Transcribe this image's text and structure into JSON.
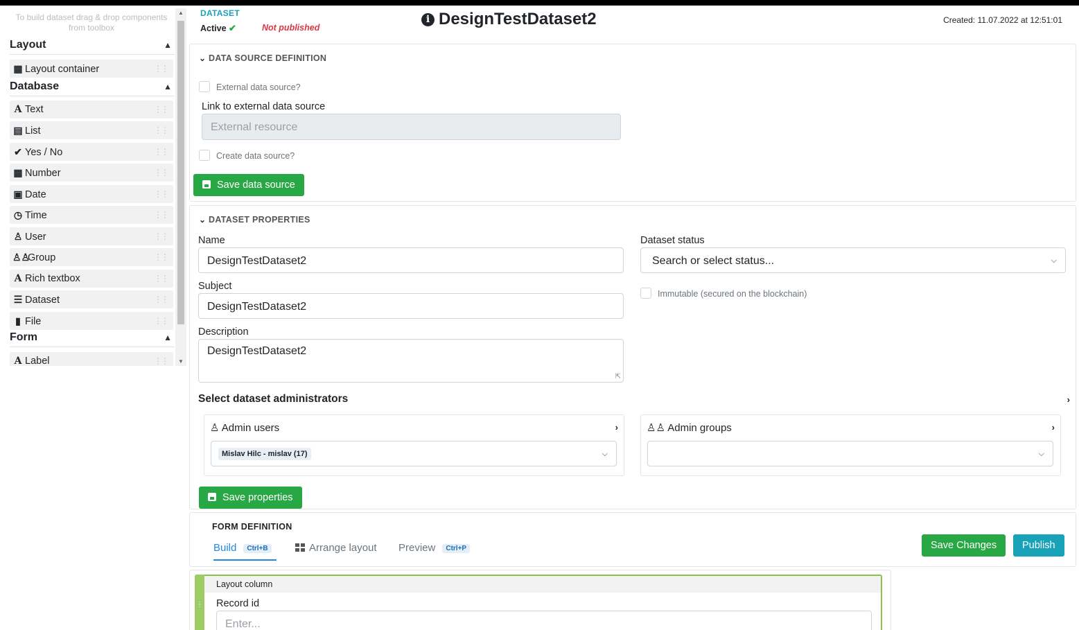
{
  "sidebar": {
    "hint": "To build dataset drag & drop components from toolbox",
    "groups": {
      "layout": "Layout",
      "database": "Database",
      "form": "Form"
    },
    "layout_items": [
      {
        "label": "Layout container",
        "icon": "layout-grid-icon"
      }
    ],
    "database_items": [
      {
        "label": "Text",
        "icon": "font-a-icon"
      },
      {
        "label": "List",
        "icon": "list-icon"
      },
      {
        "label": "Yes / No",
        "icon": "check-icon"
      },
      {
        "label": "Number",
        "icon": "calculator-icon"
      },
      {
        "label": "Date",
        "icon": "calendar-icon"
      },
      {
        "label": "Time",
        "icon": "clock-icon"
      },
      {
        "label": "User",
        "icon": "user-icon"
      },
      {
        "label": "Group",
        "icon": "users-icon"
      },
      {
        "label": "Rich textbox",
        "icon": "font-a-icon"
      },
      {
        "label": "Dataset",
        "icon": "database-icon"
      },
      {
        "label": "File",
        "icon": "file-icon"
      }
    ],
    "form_items": [
      {
        "label": "Label",
        "icon": "font-a-icon"
      }
    ]
  },
  "header": {
    "kind": "DATASET",
    "status": "Active",
    "publish_state": "Not published",
    "title": "DesignTestDataset2",
    "created": "Created: 11.07.2022 at 12:51:01"
  },
  "data_source": {
    "section_title": "DATA SOURCE DEFINITION",
    "external_label": "External data source?",
    "link_label": "Link to external data source",
    "link_placeholder": "External resource",
    "create_label": "Create data source?",
    "save_label": "Save data source"
  },
  "properties": {
    "section_title": "DATASET PROPERTIES",
    "name_label": "Name",
    "name_value": "DesignTestDataset2",
    "subject_label": "Subject",
    "subject_value": "DesignTestDataset2",
    "description_label": "Description",
    "description_value": "DesignTestDataset2",
    "status_label": "Dataset status",
    "status_placeholder": "Search or select status...",
    "immutable_label": "Immutable (secured on the blockchain)",
    "admins_title": "Select dataset administrators",
    "admin_users_title": "Admin users",
    "admin_users_selected": "Mislav Hilc - mislav (17)",
    "admin_groups_title": "Admin groups",
    "save_label": "Save properties"
  },
  "form_definition": {
    "section_title": "FORM DEFINITION",
    "tabs": [
      {
        "label": "Build",
        "shortcut": "Ctrl+B",
        "active": true
      },
      {
        "label": "Arrange layout",
        "shortcut": ""
      },
      {
        "label": "Preview",
        "shortcut": "Ctrl+P"
      }
    ],
    "save_changes_label": "Save Changes",
    "publish_label": "Publish",
    "layout_column_label": "Layout column",
    "record_id_label": "Record id",
    "record_id_placeholder": "Enter..."
  },
  "colors": {
    "green": "#28a745",
    "teal": "#17a2b8",
    "red": "#dc3545",
    "tab_blue": "#1e88e5",
    "column_green": "#8bc34a"
  }
}
